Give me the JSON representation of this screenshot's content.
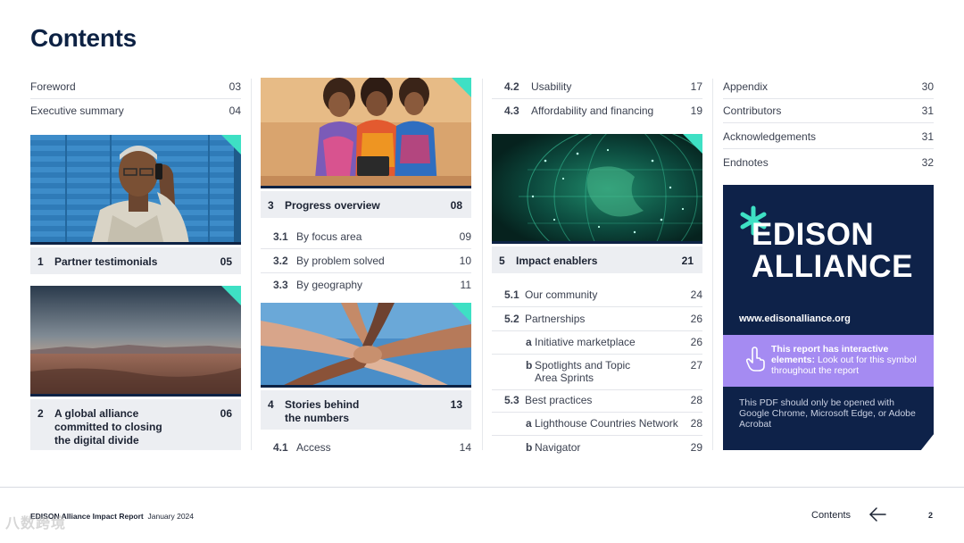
{
  "page": {
    "title": "Contents"
  },
  "col1": {
    "rows": [
      {
        "label": "Foreword",
        "page": "03"
      },
      {
        "label": "Executive summary",
        "page": "04"
      }
    ],
    "sec1": {
      "num": "1",
      "label": "Partner testimonials",
      "page": "05"
    },
    "sec2": {
      "num": "2",
      "label_lines": [
        "A global alliance",
        "committed to closing",
        "the digital divide"
      ],
      "page": "06"
    }
  },
  "col2": {
    "sec3": {
      "num": "3",
      "label": "Progress overview",
      "page": "08"
    },
    "sub3": [
      {
        "num": "3.1",
        "label": "By focus area",
        "page": "09"
      },
      {
        "num": "3.2",
        "label": "By problem solved",
        "page": "10"
      },
      {
        "num": "3.3",
        "label": "By geography",
        "page": "11"
      }
    ],
    "sec4": {
      "num": "4",
      "label_lines": [
        "Stories behind",
        "the numbers"
      ],
      "page": "13"
    },
    "sub4": [
      {
        "num": "4.1",
        "label": "Access",
        "page": "14"
      }
    ]
  },
  "col3": {
    "sub4": [
      {
        "num": "4.2",
        "label": "Usability",
        "page": "17"
      },
      {
        "num": "4.3",
        "label": "Affordability and financing",
        "page": "19"
      }
    ],
    "sec5": {
      "num": "5",
      "label": "Impact enablers",
      "page": "21"
    },
    "sub5": [
      {
        "num": "5.1",
        "label": "Our community",
        "page": "24"
      },
      {
        "num": "5.2",
        "label": "Partnerships",
        "page": "26"
      },
      {
        "num": "a",
        "label": "Initiative marketplace",
        "page": "26"
      },
      {
        "num": "b",
        "label_lines": [
          "Spotlights and Topic",
          "Area Sprints"
        ],
        "page": "27"
      },
      {
        "num": "5.3",
        "label": "Best practices",
        "page": "28"
      },
      {
        "num": "a",
        "label": "Lighthouse Countries Network",
        "page": "28"
      },
      {
        "num": "b",
        "label": "Navigator",
        "page": "29"
      }
    ]
  },
  "col4": {
    "rows": [
      {
        "label": "Appendix",
        "page": "30"
      },
      {
        "label": "Contributors",
        "page": "31"
      },
      {
        "label": "Acknowledgements",
        "page": "31"
      },
      {
        "label": "Endnotes",
        "page": "32"
      }
    ],
    "brand": {
      "logo_line1": "EDISON",
      "logo_line2": "ALLIANCE",
      "url": "www.edisonalliance.org",
      "interactive_bold": "This report has interactive elements:",
      "interactive_rest": " Look out for this symbol throughout the report",
      "pdf_note": "This PDF should only be opened with Google Chrome, Microsoft Edge, or Adobe Acrobat"
    }
  },
  "footer": {
    "report": "EDISON Alliance Impact Report",
    "date": "January 2024",
    "nav_label": "Contents",
    "page_number": "2",
    "watermark": "八数跨境"
  },
  "colors": {
    "navy": "#0d2244",
    "teal": "#3ee0c4",
    "purple": "#a58bf2",
    "bar": "#eceef2"
  }
}
